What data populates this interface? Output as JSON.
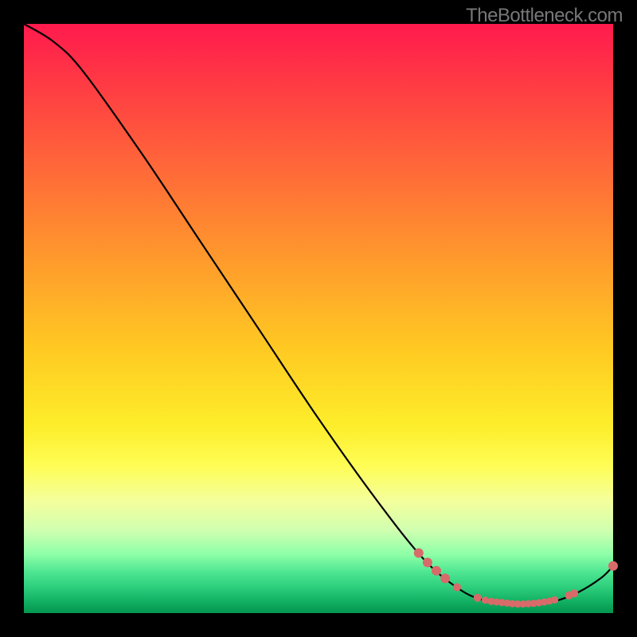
{
  "watermark": "TheBottleneck.com",
  "chart_data": {
    "type": "line",
    "title": "",
    "xlabel": "",
    "ylabel": "",
    "xlim": [
      0,
      100
    ],
    "ylim": [
      0,
      100
    ],
    "curve": [
      {
        "x": 0,
        "y": 100
      },
      {
        "x": 5,
        "y": 97
      },
      {
        "x": 10,
        "y": 92
      },
      {
        "x": 20,
        "y": 78
      },
      {
        "x": 30,
        "y": 63
      },
      {
        "x": 40,
        "y": 48
      },
      {
        "x": 50,
        "y": 33
      },
      {
        "x": 60,
        "y": 19
      },
      {
        "x": 68,
        "y": 9
      },
      {
        "x": 74,
        "y": 4
      },
      {
        "x": 78,
        "y": 2.2
      },
      {
        "x": 82,
        "y": 1.5
      },
      {
        "x": 86,
        "y": 1.5
      },
      {
        "x": 90,
        "y": 2
      },
      {
        "x": 94,
        "y": 3.5
      },
      {
        "x": 98,
        "y": 6
      },
      {
        "x": 100,
        "y": 8
      }
    ],
    "markers": [
      {
        "x": 67,
        "y": 10.2,
        "r": 6
      },
      {
        "x": 68.5,
        "y": 8.6,
        "r": 6
      },
      {
        "x": 70,
        "y": 7.2,
        "r": 6
      },
      {
        "x": 71.5,
        "y": 5.9,
        "r": 6
      },
      {
        "x": 73.5,
        "y": 4.4,
        "r": 5
      },
      {
        "x": 77,
        "y": 2.6,
        "r": 5
      },
      {
        "x": 78.3,
        "y": 2.2,
        "r": 4.5
      },
      {
        "x": 79.3,
        "y": 2.0,
        "r": 4.5
      },
      {
        "x": 80.2,
        "y": 1.9,
        "r": 4.5
      },
      {
        "x": 81.1,
        "y": 1.8,
        "r": 4.5
      },
      {
        "x": 82.0,
        "y": 1.7,
        "r": 4.5
      },
      {
        "x": 82.9,
        "y": 1.6,
        "r": 4.5
      },
      {
        "x": 83.8,
        "y": 1.55,
        "r": 4.5
      },
      {
        "x": 84.7,
        "y": 1.55,
        "r": 4.5
      },
      {
        "x": 85.6,
        "y": 1.6,
        "r": 4.5
      },
      {
        "x": 86.5,
        "y": 1.65,
        "r": 4.5
      },
      {
        "x": 87.4,
        "y": 1.75,
        "r": 4.5
      },
      {
        "x": 88.3,
        "y": 1.9,
        "r": 4.5
      },
      {
        "x": 89.2,
        "y": 2.05,
        "r": 4.5
      },
      {
        "x": 90.1,
        "y": 2.25,
        "r": 4.5
      },
      {
        "x": 92.5,
        "y": 3.0,
        "r": 5
      },
      {
        "x": 93.4,
        "y": 3.35,
        "r": 5
      },
      {
        "x": 100,
        "y": 8,
        "r": 6
      }
    ]
  }
}
